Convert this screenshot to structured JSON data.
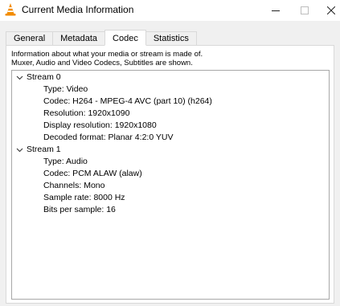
{
  "window": {
    "title": "Current Media Information",
    "colors": {
      "title_bg": "#ffffff",
      "content_bg": "#f0f0f0",
      "icon_orange": "#f28c00"
    }
  },
  "tabs": [
    {
      "label": "General",
      "active": false
    },
    {
      "label": "Metadata",
      "active": false
    },
    {
      "label": "Codec",
      "active": true
    },
    {
      "label": "Statistics",
      "active": false
    }
  ],
  "codec": {
    "info_line1": "Information about what your media or stream is made of.",
    "info_line2": "Muxer, Audio and Video Codecs, Subtitles are shown.",
    "streams": [
      {
        "label": "Stream 0",
        "expanded": true,
        "details": [
          "Type: Video",
          "Codec: H264 - MPEG-4 AVC (part 10) (h264)",
          "Resolution: 1920x1090",
          "Display resolution: 1920x1080",
          "Decoded format: Planar 4:2:0 YUV"
        ]
      },
      {
        "label": "Stream 1",
        "expanded": true,
        "details": [
          "Type: Audio",
          "Codec: PCM ALAW (alaw)",
          "Channels: Mono",
          "Sample rate: 8000 Hz",
          "Bits per sample: 16"
        ]
      }
    ]
  },
  "icons": {
    "app": "vlc-cone-icon",
    "minimize": "minimize-icon",
    "maximize": "maximize-icon",
    "close": "close-icon",
    "expand": "chevron-down-icon"
  }
}
